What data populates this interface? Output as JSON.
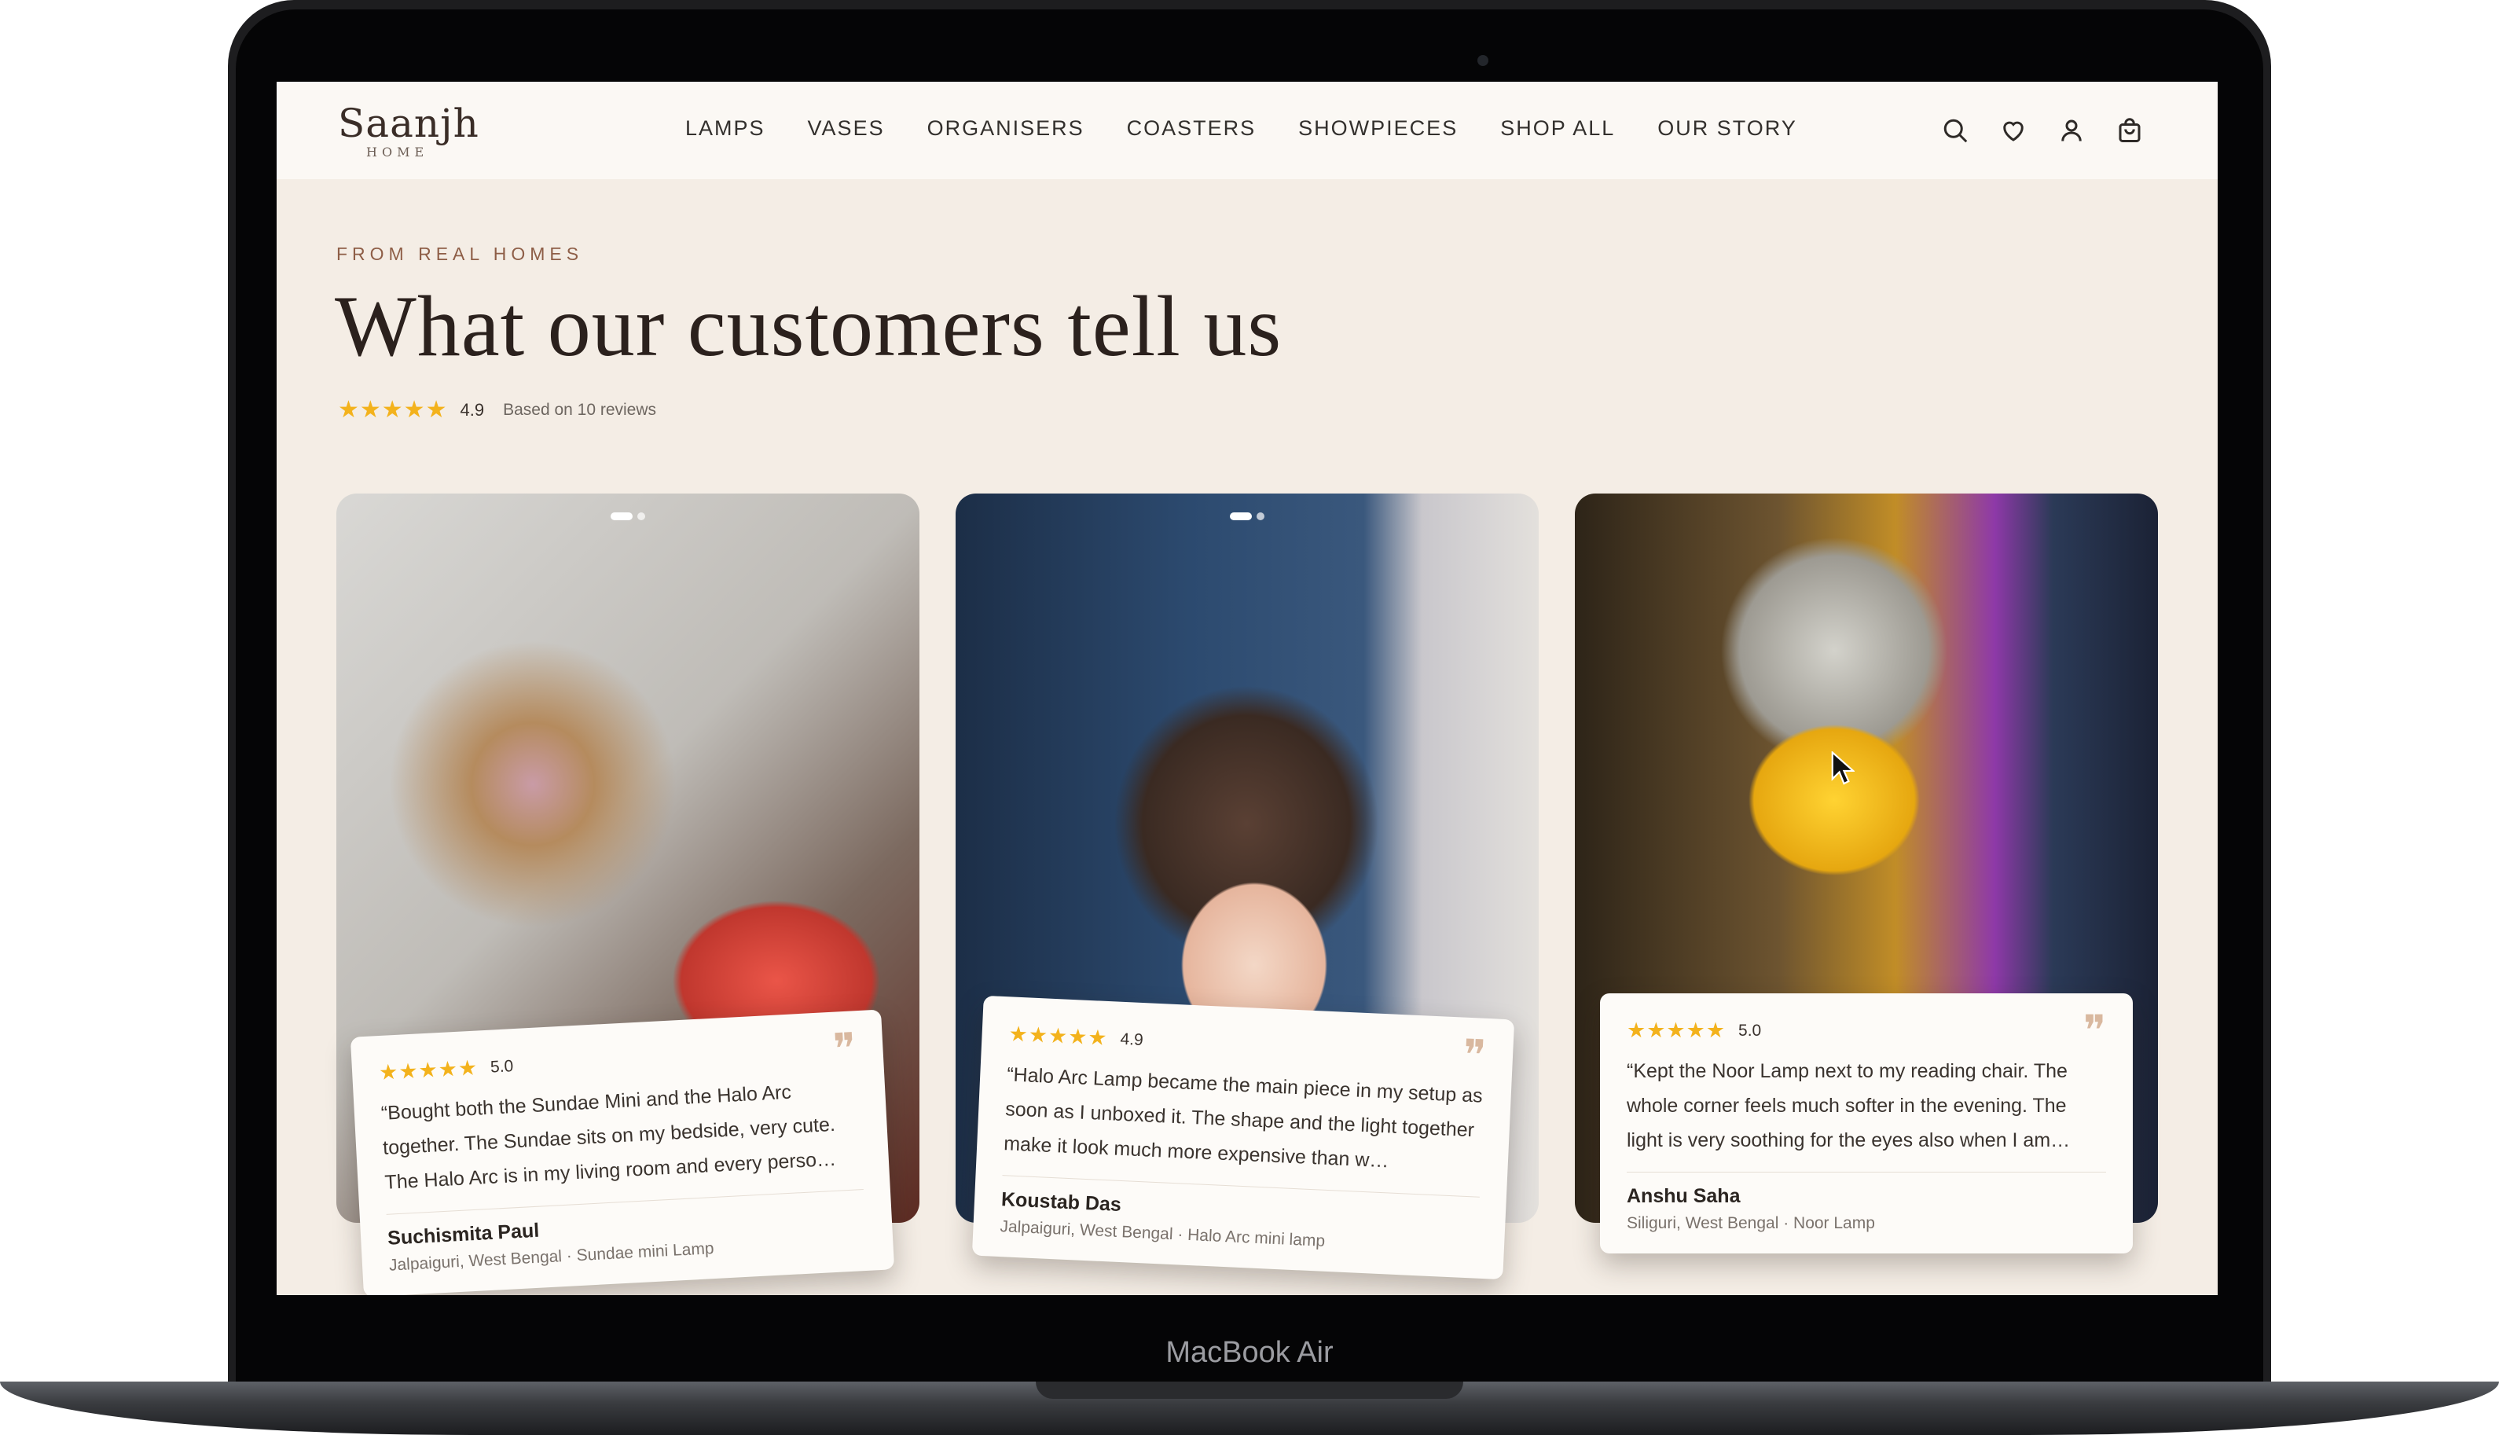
{
  "device": {
    "label": "MacBook Air"
  },
  "header": {
    "logo": {
      "name": "Saanjh",
      "sub": "HOME"
    },
    "nav": [
      "LAMPS",
      "VASES",
      "ORGANISERS",
      "COASTERS",
      "SHOWPIECES",
      "SHOP ALL",
      "OUR STORY"
    ],
    "icons": [
      "search-icon",
      "heart-icon",
      "user-icon",
      "cart-icon"
    ]
  },
  "hero": {
    "eyebrow": "FROM REAL HOMES",
    "title": "What our customers tell us",
    "stars": "★★★★★",
    "rating": "4.9",
    "note": "Based on 10 reviews"
  },
  "reviews": [
    {
      "stars": "★★★★★",
      "score": "5.0",
      "quote_icon": "❞",
      "text": "“Bought both the Sundae Mini and the Halo Arc together. The Sundae sits on my bedside, very cute. The Halo Arc is in my living room and every perso…",
      "name": "Suchismita Paul",
      "meta": "Jalpaiguri, West Bengal · Sundae mini Lamp"
    },
    {
      "stars": "★★★★★",
      "score": "4.9",
      "quote_icon": "❞",
      "text": "“Halo Arc Lamp became the main piece in my setup as soon as I unboxed it. The shape and the light together make it look much more expensive than w…",
      "name": "Koustab Das",
      "meta": "Jalpaiguri, West Bengal · Halo Arc mini lamp"
    },
    {
      "stars": "★★★★★",
      "score": "5.0",
      "quote_icon": "❞",
      "text": "“Kept the Noor Lamp next to my reading chair. The whole corner feels much softer in the evening. The light is very soothing for the eyes also when I am…",
      "name": "Anshu Saha",
      "meta": "Siliguri, West Bengal · Noor Lamp"
    }
  ],
  "colors": {
    "accent_star": "#f3b21c",
    "background": "#f4ede5",
    "eyebrow": "#8e5e47"
  }
}
